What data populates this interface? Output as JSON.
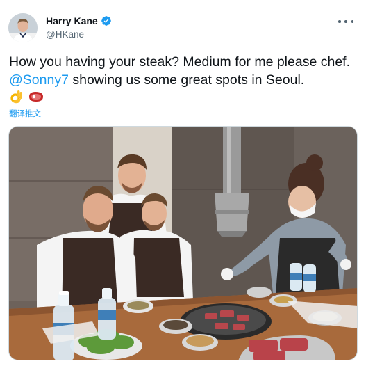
{
  "user": {
    "display_name": "Harry Kane",
    "handle": "@HKane",
    "verified_icon": "verified-badge-icon",
    "avatar_icon": "profile-photo"
  },
  "tweet": {
    "text_before": "How you having your steak? Medium for me please chef. ",
    "mention": "@Sonny7",
    "text_after": " showing us some great spots in Seoul.",
    "emojis": [
      "ok-hand-emoji",
      "cut-of-meat-emoji"
    ],
    "translate_label": "翻译推文"
  },
  "media": {
    "type": "photo",
    "description_icon": "restaurant-bbq-photo"
  },
  "menu": {
    "icon": "more-options-icon"
  },
  "colors": {
    "link": "#1d9bf0",
    "secondary_text": "#536471",
    "verified": "#1d9bf0"
  }
}
